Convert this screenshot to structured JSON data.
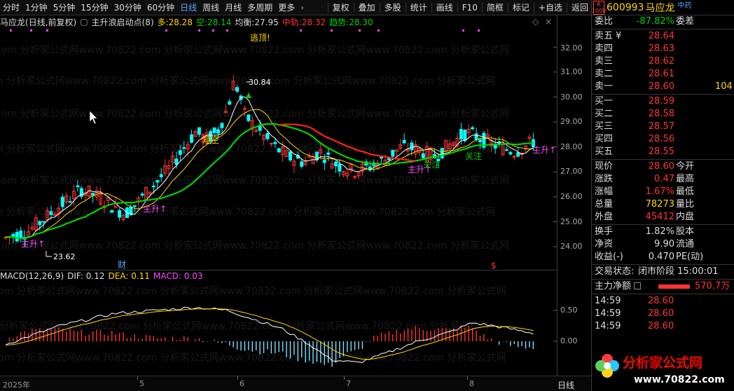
{
  "toolbar": {
    "left": [
      {
        "label": "分时",
        "active": false
      },
      {
        "label": "1分钟",
        "active": false
      },
      {
        "label": "5分钟",
        "active": false
      },
      {
        "label": "15分钟",
        "active": false
      },
      {
        "label": "30分钟",
        "active": false
      },
      {
        "label": "60分钟",
        "active": false
      },
      {
        "label": "日线",
        "active": true
      },
      {
        "label": "周线",
        "active": false
      },
      {
        "label": "月线",
        "active": false
      },
      {
        "label": "多周期",
        "active": false
      },
      {
        "label": "更多",
        "active": false
      }
    ],
    "more_arrow": "›",
    "right": [
      "复权",
      "叠加",
      "多股",
      "统计",
      "画线",
      "F10",
      "简框",
      "标记",
      "+自选",
      "返回"
    ]
  },
  "chart": {
    "stock": "马应龙",
    "mode": "(日线,前复权)",
    "indicator": "主升浪启动点(8)",
    "items": [
      {
        "label": "多:",
        "value": "28.28",
        "color": "#ffd700"
      },
      {
        "label": "空:",
        "value": "28.14",
        "color": "#00d000"
      },
      {
        "label": "均衡:",
        "value": "27.95",
        "color": "#dddddd"
      },
      {
        "label": "中轨:",
        "value": "28.32",
        "color": "#ff3333"
      },
      {
        "label": "趋势:",
        "value": "28.30",
        "color": "#00d000"
      }
    ],
    "price_labels": [
      "32.00",
      "31.00",
      "30.00",
      "29.00",
      "28.00",
      "27.00",
      "26.00",
      "25.00",
      "24.00"
    ],
    "annotations": {
      "escape": "逃顶!",
      "high": "30.84",
      "low": "23.62",
      "short_empty": "短空",
      "main_up": "主升↑",
      "attention": "关注",
      "cai": "财",
      "dollar": "$"
    },
    "macd_labels": [
      "0.50",
      "0.00"
    ],
    "xlabels": [
      "2025年",
      "5",
      "6",
      "7",
      "8"
    ],
    "bottom_right": "日线"
  },
  "macd": {
    "name": "MACD(12,26,9)",
    "dif_label": "DIF:",
    "dif": "0.12",
    "dea_label": "DEA:",
    "dea": "0.11",
    "macd_label": "MACD:",
    "macd": "0.03"
  },
  "watermark": ".com 分析家公式网www.70822.com 分析家公式网www.70822.com 分析家公式网www.70822.com 分析家公式网",
  "quote": {
    "r_badge": [
      "R",
      "1000"
    ],
    "code": "600993",
    "name": "马应龙",
    "tag": "中药",
    "weibi_label": "委比",
    "weibi": "-87.82%",
    "weicha_label": "委差",
    "sell": [
      {
        "label": "卖五",
        "price": "28.64",
        "vol": ""
      },
      {
        "label": "卖四",
        "price": "28.63",
        "vol": ""
      },
      {
        "label": "卖三",
        "price": "28.62",
        "vol": ""
      },
      {
        "label": "卖二",
        "price": "28.61",
        "vol": ""
      },
      {
        "label": "卖一",
        "price": "28.60",
        "vol": "104"
      }
    ],
    "yen": "¥",
    "buy": [
      {
        "label": "买一",
        "price": "28.59"
      },
      {
        "label": "买二",
        "price": "28.58"
      },
      {
        "label": "买三",
        "price": "28.57"
      },
      {
        "label": "买四",
        "price": "28.56"
      },
      {
        "label": "买五",
        "price": "28.55"
      }
    ],
    "stats": [
      {
        "l": "现价",
        "v": "28.60",
        "vc": "red",
        "r": "今开",
        "rv": ""
      },
      {
        "l": "涨跌",
        "v": "0.47",
        "vc": "red",
        "r": "最高",
        "rv": ""
      },
      {
        "l": "涨幅",
        "v": "1.67%",
        "vc": "red",
        "r": "最低",
        "rv": ""
      },
      {
        "l": "总量",
        "v": "78273",
        "vc": "yel",
        "r": "量比",
        "rv": ""
      },
      {
        "l": "外盘",
        "v": "45412",
        "vc": "red",
        "r": "内盘",
        "rv": ""
      }
    ],
    "stats2": [
      {
        "l": "换手",
        "v": "1.82%",
        "r": "股本"
      },
      {
        "l": "净资",
        "v": "9.90",
        "r": "流通"
      },
      {
        "l": "收益(-)",
        "v": "0.470",
        "r": "PE(动)"
      }
    ],
    "status_label": "交易状态:",
    "status": "闭市阶段 15:00:01",
    "netflow_label": "主力净额",
    "netflow": "570.7万",
    "ticks": [
      {
        "t": "14:59",
        "p": "28.60"
      },
      {
        "t": "14:59",
        "p": "28.60"
      },
      {
        "t": "14:59",
        "p": "28.60"
      }
    ],
    "logo_text": "分析家公式网",
    "logo_url": "www.70822.com"
  }
}
